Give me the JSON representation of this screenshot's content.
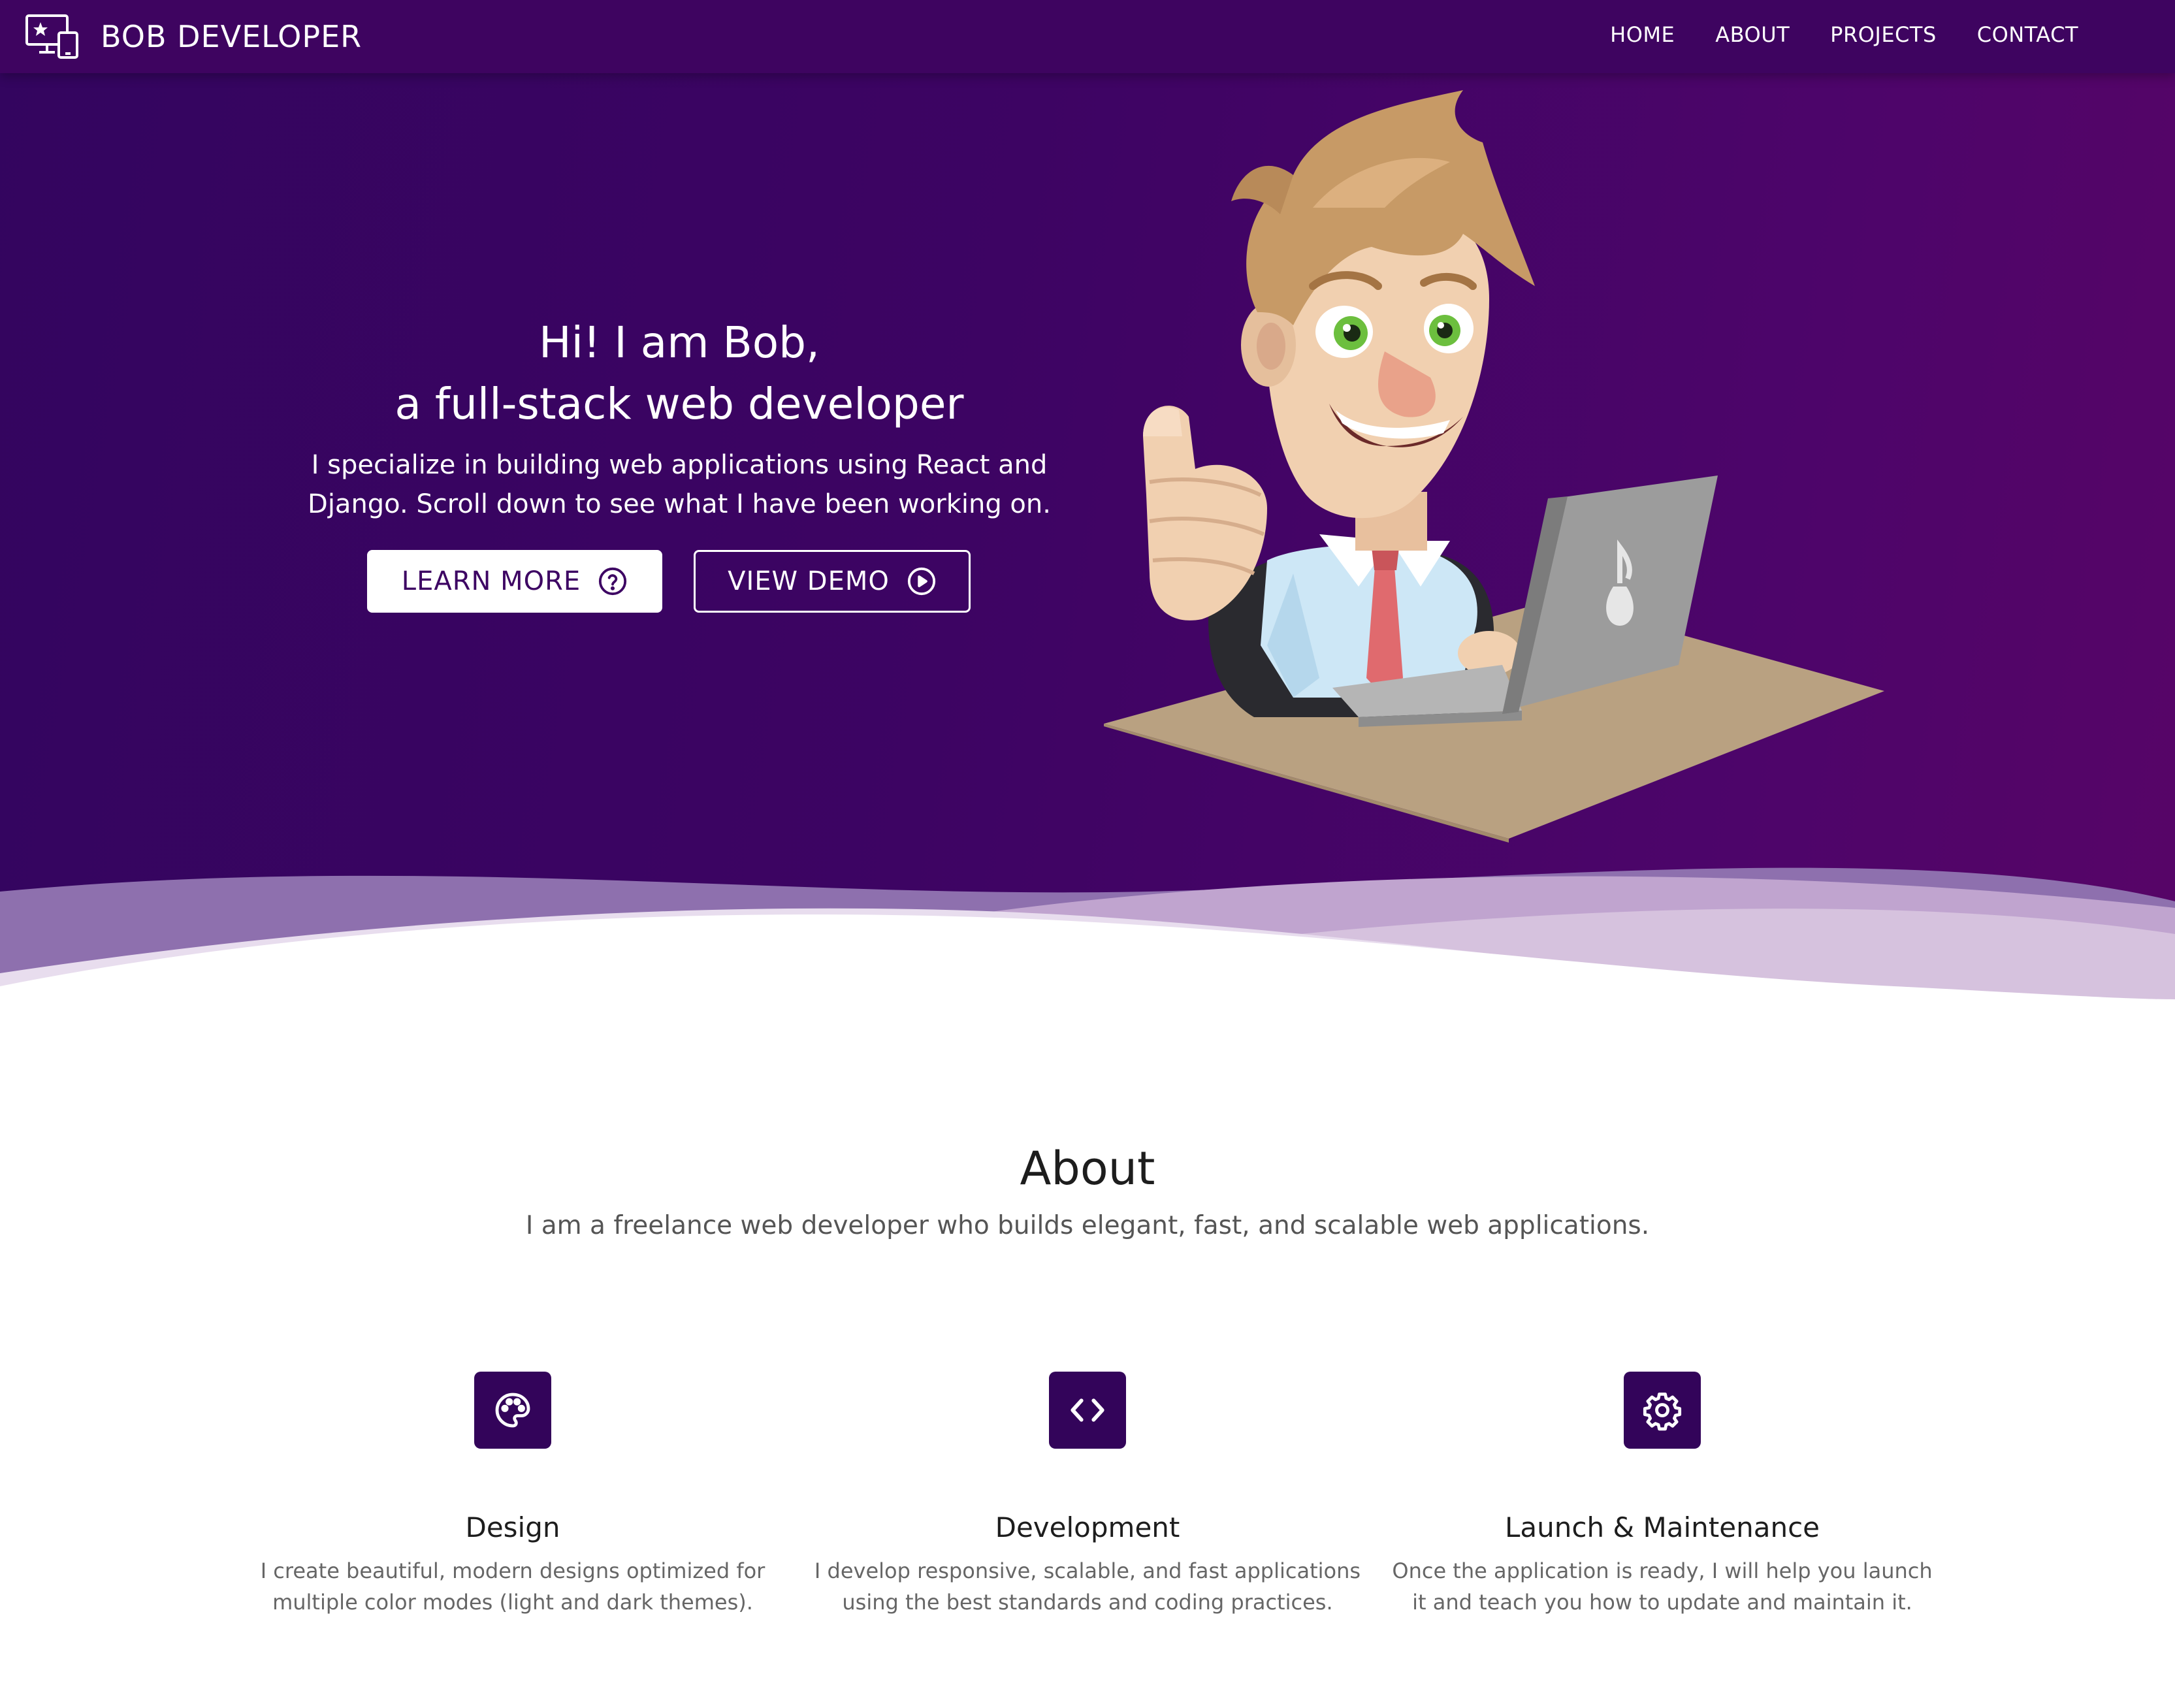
{
  "navbar": {
    "brand_name": "BOB DEVELOPER",
    "brand_icon": "devices-star-icon",
    "links": [
      "HOME",
      "ABOUT",
      "PROJECTS",
      "CONTACT"
    ]
  },
  "hero": {
    "title_line1": "Hi! I am Bob,",
    "title_line2": "a full-stack web developer",
    "subtitle_line1": "I specialize in building web applications using React and",
    "subtitle_line2": "Django. Scroll down to see what I have been working on.",
    "learn_more_label": "LEARN MORE",
    "learn_more_icon": "question-circle-icon",
    "view_demo_label": "VIEW DEMO",
    "view_demo_icon": "play-circle-icon",
    "illustration": "developer-thumbs-up-laptop"
  },
  "about": {
    "title": "About",
    "subtitle": "I am a freelance web developer who builds elegant, fast, and scalable web applications."
  },
  "features": [
    {
      "icon": "palette-icon",
      "title": "Design",
      "desc_line1": "I create beautiful, modern designs optimized for",
      "desc_line2": "multiple color modes (light and dark themes)."
    },
    {
      "icon": "code-icon",
      "title": "Development",
      "desc_line1": "I develop responsive, scalable, and fast applications",
      "desc_line2": "using the best standards and coding practices."
    },
    {
      "icon": "gear-icon",
      "title": "Launch & Maintenance",
      "desc_line1": "Once the application is ready, I will help you launch",
      "desc_line2": "it and teach you how to update and maintain it."
    }
  ],
  "colors": {
    "primary": "#3d0463",
    "icon_tile": "#33045a",
    "wave_light": "#e8ddee",
    "desk": "#b9a181"
  }
}
